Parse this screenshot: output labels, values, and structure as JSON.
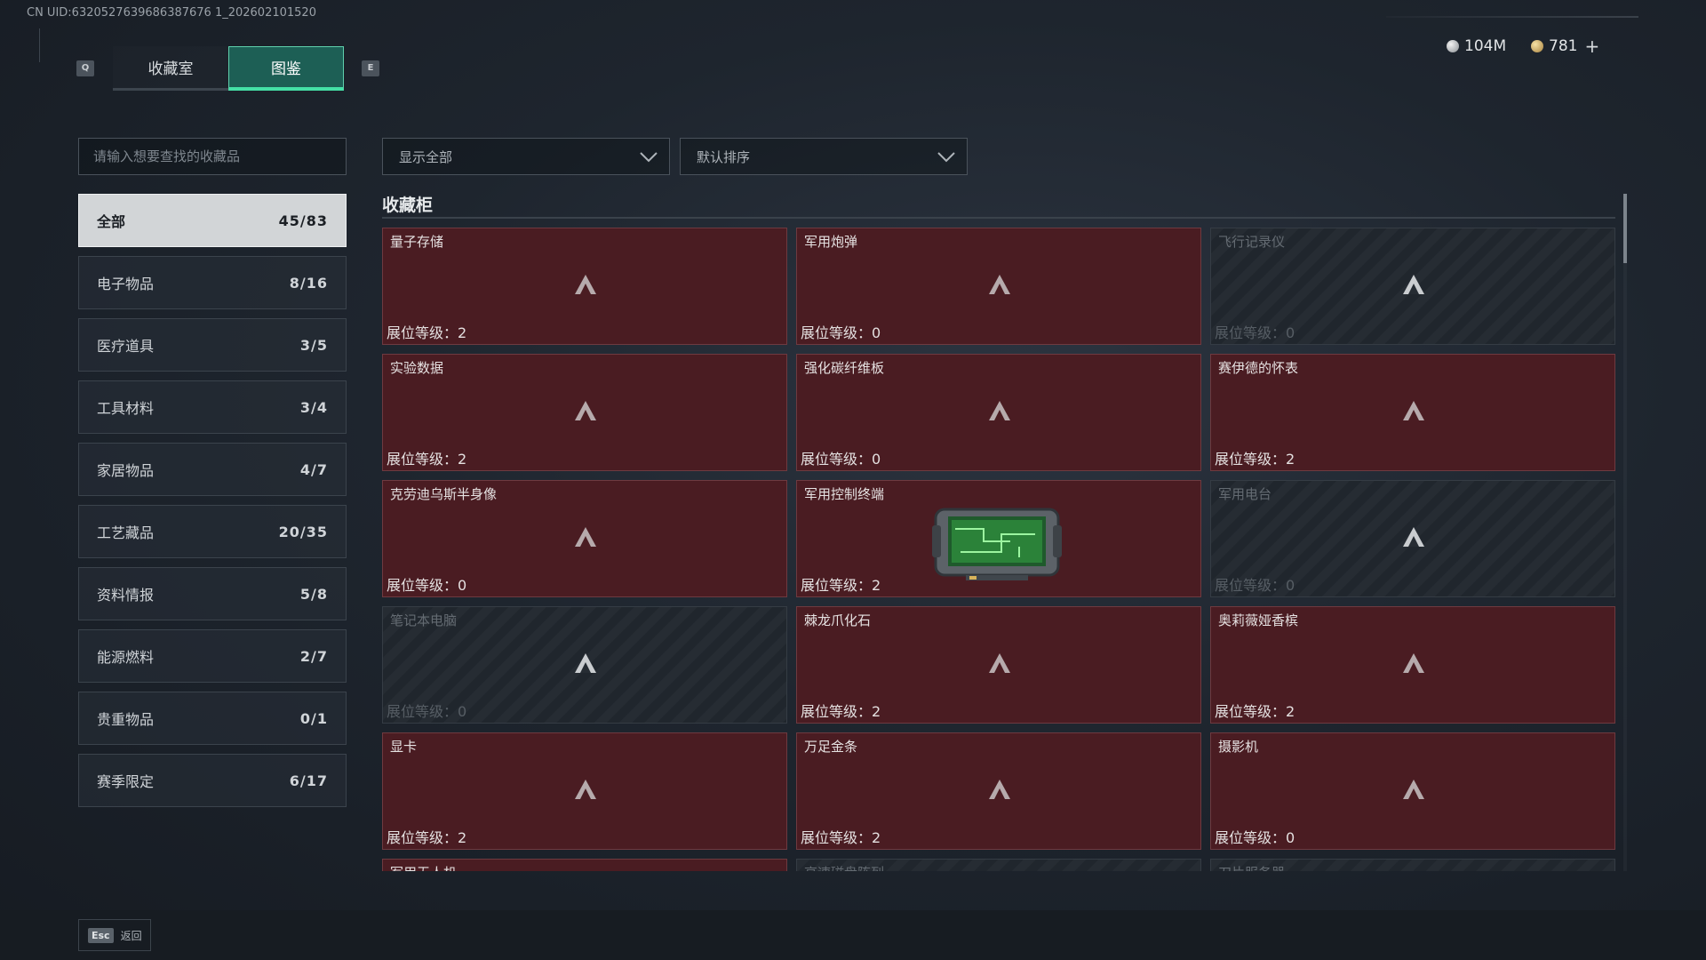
{
  "uid_text": "CN UID:6320527639686387676 1_202602101520",
  "tabs": {
    "left_key": "Q",
    "right_key": "E",
    "items": [
      {
        "label": "收藏室"
      },
      {
        "label": "图鉴"
      }
    ],
    "active_index": 1
  },
  "currency": {
    "silver": "104M",
    "gold": "781"
  },
  "search": {
    "placeholder": "请输入想要查找的收藏品"
  },
  "filters": {
    "show": "显示全部",
    "sort": "默认排序"
  },
  "categories": [
    {
      "label": "全部",
      "count": "45/83",
      "active": true
    },
    {
      "label": "电子物品",
      "count": "8/16"
    },
    {
      "label": "医疗道具",
      "count": "3/5"
    },
    {
      "label": "工具材料",
      "count": "3/4"
    },
    {
      "label": "家居物品",
      "count": "4/7"
    },
    {
      "label": "工艺藏品",
      "count": "20/35"
    },
    {
      "label": "资料情报",
      "count": "5/8"
    },
    {
      "label": "能源燃料",
      "count": "2/7"
    },
    {
      "label": "贵重物品",
      "count": "0/1"
    },
    {
      "label": "赛季限定",
      "count": "6/17"
    }
  ],
  "section_title": "收藏柜",
  "level_label": "展位等级：",
  "items": [
    {
      "name": "量子存储",
      "level": "2",
      "locked": false
    },
    {
      "name": "军用炮弹",
      "level": "0",
      "locked": false
    },
    {
      "name": "飞行记录仪",
      "level": "0",
      "locked": true
    },
    {
      "name": "实验数据",
      "level": "2",
      "locked": false
    },
    {
      "name": "强化碳纤维板",
      "level": "0",
      "locked": false
    },
    {
      "name": "赛伊德的怀表",
      "level": "2",
      "locked": false
    },
    {
      "name": "克劳迪乌斯半身像",
      "level": "0",
      "locked": false
    },
    {
      "name": "军用控制终端",
      "level": "2",
      "locked": false,
      "has_image": true
    },
    {
      "name": "军用电台",
      "level": "0",
      "locked": true
    },
    {
      "name": "笔记本电脑",
      "level": "0",
      "locked": true
    },
    {
      "name": "棘龙爪化石",
      "level": "2",
      "locked": false
    },
    {
      "name": "奥莉薇娅香槟",
      "level": "2",
      "locked": false
    },
    {
      "name": "显卡",
      "level": "2",
      "locked": false
    },
    {
      "name": "万足金条",
      "level": "2",
      "locked": false
    },
    {
      "name": "摄影机",
      "level": "0",
      "locked": false
    },
    {
      "name": "军用无人机",
      "level": "",
      "locked": false
    },
    {
      "name": "高速磁盘阵列",
      "level": "",
      "locked": true
    },
    {
      "name": "刀片服务器",
      "level": "",
      "locked": true
    }
  ],
  "footer": {
    "key": "Esc",
    "label": "返回"
  }
}
